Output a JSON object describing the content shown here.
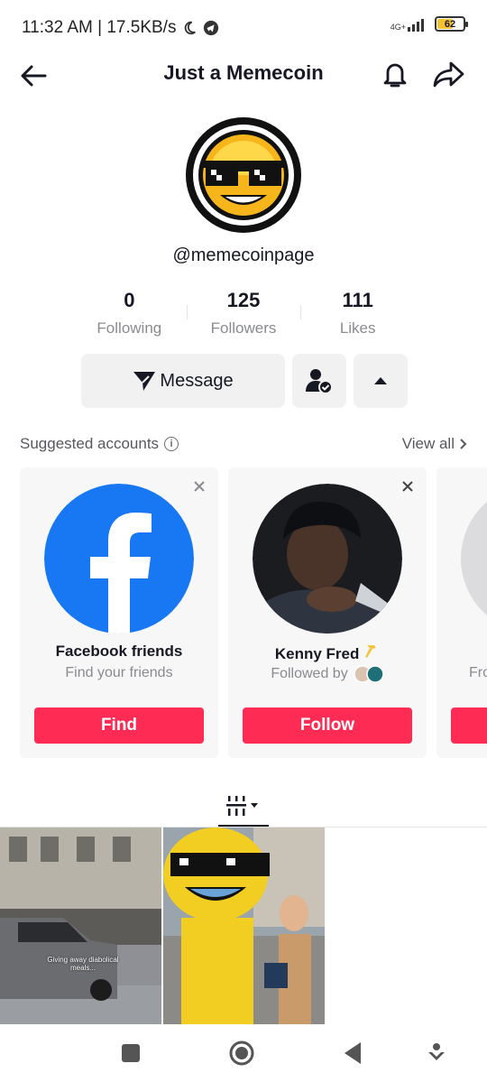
{
  "status_bar": {
    "time_speed": "11:32 AM | 17.5KB/s",
    "network": "4G+",
    "battery": "62",
    "battery_level": 0.62
  },
  "header": {
    "title": "Just a Memecoin"
  },
  "profile": {
    "username": "@memecoinpage",
    "stats": [
      {
        "value": "0",
        "label": "Following"
      },
      {
        "value": "125",
        "label": "Followers"
      },
      {
        "value": "111",
        "label": "Likes"
      }
    ],
    "message_label": "Message"
  },
  "suggested": {
    "title": "Suggested accounts",
    "view_all": "View all",
    "cards": [
      {
        "name": "Facebook friends",
        "subtitle": "Find your friends",
        "button": "Find"
      },
      {
        "name": "Kenny Fred",
        "subtitle": "Followed by",
        "button": "Follow"
      },
      {
        "name": "",
        "subtitle": "Fro",
        "button": ""
      }
    ]
  },
  "videos": [
    {
      "caption": "Giving away diabolical meals..."
    },
    {
      "caption": ""
    }
  ],
  "colors": {
    "accent": "#fe2c55",
    "facebook": "#1877f2",
    "text": "#161823",
    "muted": "#8a8b91"
  }
}
